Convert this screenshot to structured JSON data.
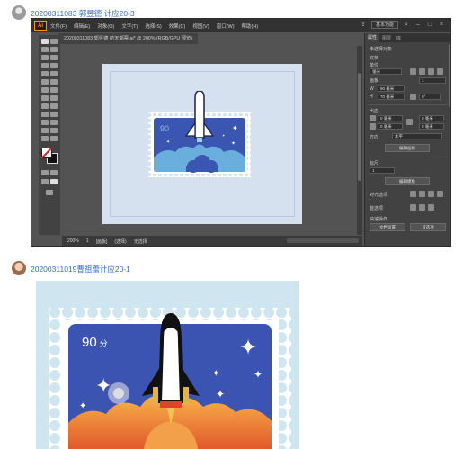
{
  "posts": [
    {
      "username": "20200311083 郭昱德 计应20-3",
      "avatar": "avatar-gray",
      "screenshot": {
        "app": "Adobe Illustrator",
        "menu": [
          "文件(F)",
          "编辑(E)",
          "对象(O)",
          "文字(T)",
          "选择(S)",
          "效果(C)",
          "视图(V)",
          "窗口(W)",
          "帮助(H)"
        ],
        "menu_right": "基本功能",
        "doc_tab": "20200311083 郭昱德 航天邮票.ai* @ 200% (RGB/GPU 预览)",
        "stamp_value": "90",
        "stamp_unit": "分",
        "status": {
          "zoom": "200%",
          "artboard_nav": "1",
          "mode": "[画板]",
          "select": "(选择)",
          "info": "无选择"
        },
        "panel": {
          "tabs": [
            "属性",
            "图层",
            "库"
          ],
          "active_tab": "属性",
          "heading": "未选择对象",
          "doc_label": "文档",
          "unit_label": "单位",
          "unit_value": "毫米",
          "artboard_label": "画板",
          "artboard_value": "1",
          "width_value": "90 毫米",
          "height_value": "70 毫米",
          "rotate_value": "0°",
          "bleed_label": "出血",
          "bleed_values": [
            "0 毫米",
            "0 毫米",
            "0 毫米",
            "0 毫米"
          ],
          "direction_label": "方向",
          "direction_value": "水平",
          "edit_artboard": "编辑画板",
          "rulers_label": "标尺",
          "ruler_value": "1",
          "edit_template": "编辑模板",
          "snap_label": "对齐选项",
          "prefs_label": "首选项",
          "quick_label": "快速操作",
          "doc_settings": "文档设置",
          "prefs_button": "首选项"
        }
      }
    },
    {
      "username": "20200311019曹祖蕾计应20-1",
      "avatar": "avatar-photo",
      "image": {
        "stamp_value": "90",
        "stamp_unit": "分"
      }
    }
  ]
}
